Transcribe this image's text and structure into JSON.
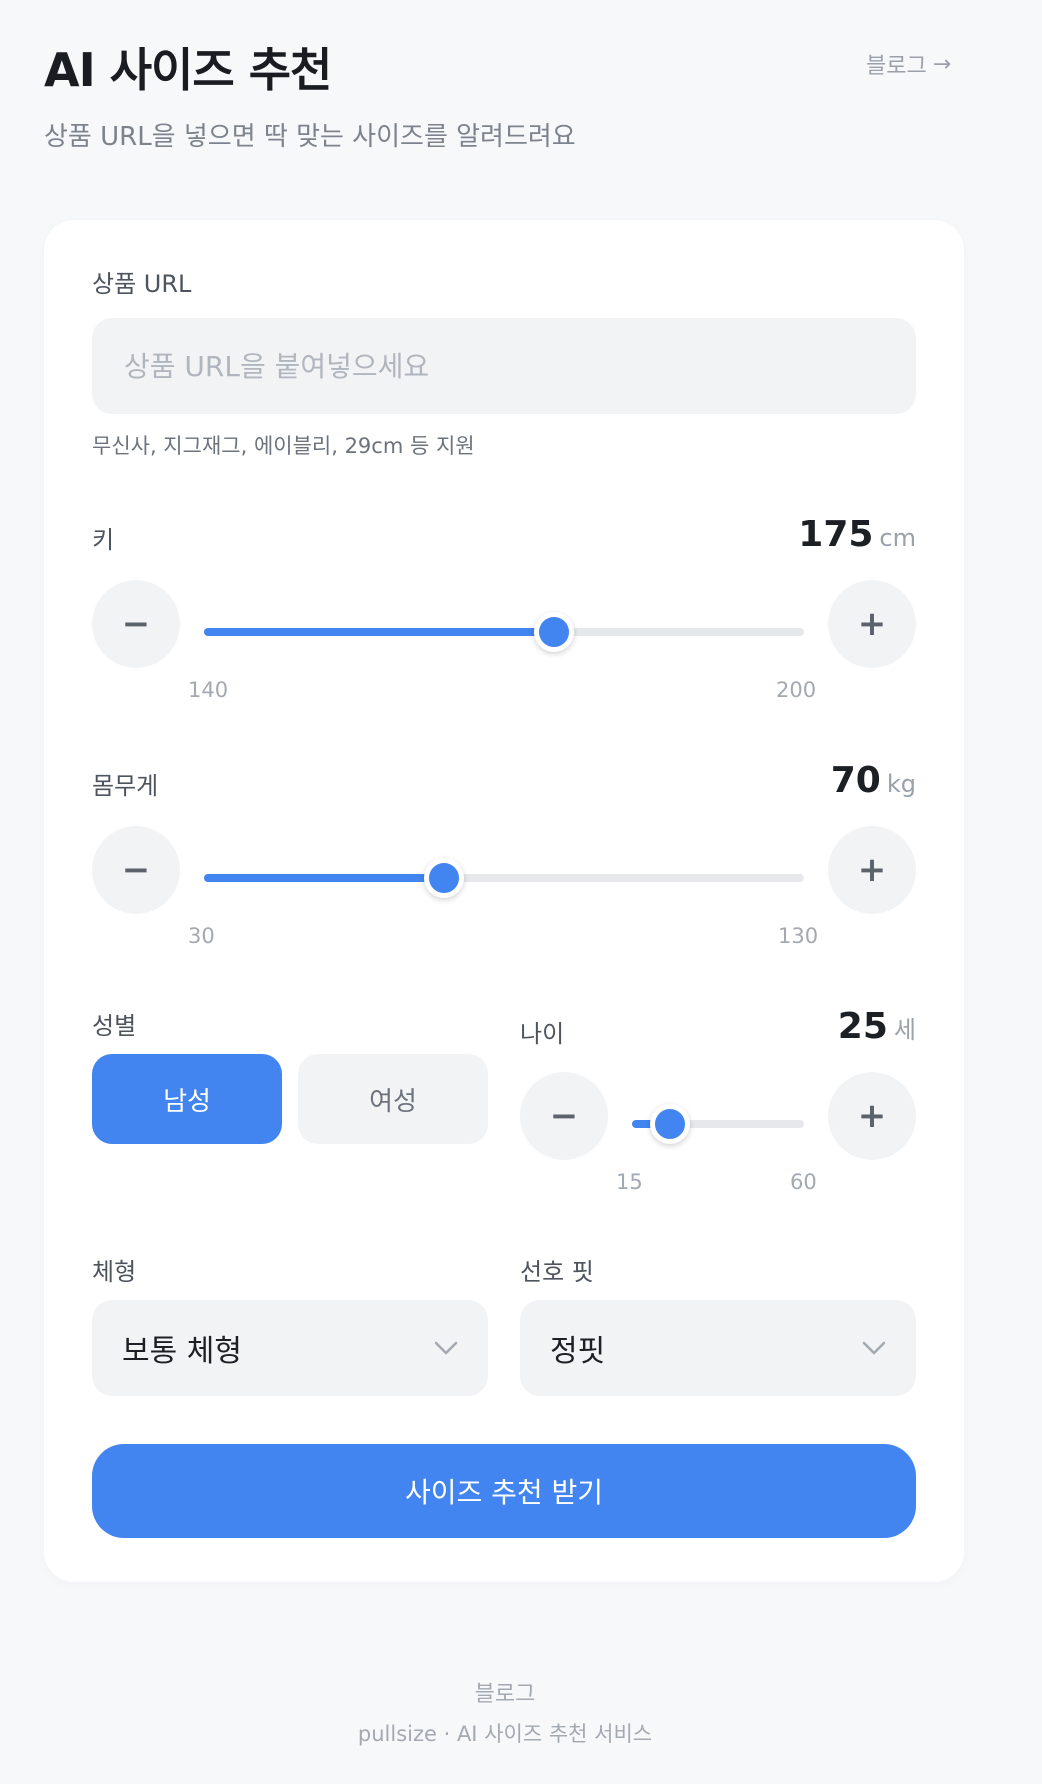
{
  "header": {
    "title": "AI 사이즈 추천",
    "subtitle": "상품 URL을 넣으면 딱 맞는 사이즈를 알려드려요",
    "blog_link": "블로그",
    "blog_arrow": "→"
  },
  "form": {
    "url": {
      "label": "상품 URL",
      "placeholder": "상품 URL을 붙여넣으세요",
      "value": "",
      "helper": "무신사, 지그재그, 에이블리, 29cm 등 지원"
    },
    "height": {
      "label": "키",
      "value": "175",
      "unit": "cm",
      "min": "140",
      "max": "200",
      "minus": "−",
      "plus": "+"
    },
    "weight": {
      "label": "몸무게",
      "value": "70",
      "unit": "kg",
      "min": "30",
      "max": "130",
      "minus": "−",
      "plus": "+"
    },
    "gender": {
      "label": "성별",
      "options": [
        "남성",
        "여성"
      ],
      "selected": "남성"
    },
    "age": {
      "label": "나이",
      "value": "25",
      "unit": "세",
      "min": "15",
      "max": "60",
      "minus": "−",
      "plus": "+"
    },
    "body_type": {
      "label": "체형",
      "value": "보통 체형"
    },
    "fit": {
      "label": "선호 핏",
      "value": "정핏"
    },
    "submit": "사이즈 추천 받기"
  },
  "footer": {
    "link": "블로그",
    "text": "pullsize · AI 사이즈 추천 서비스"
  },
  "colors": {
    "accent": "#4285f0",
    "background": "#f7f8fa",
    "card": "#ffffff",
    "input_bg": "#f2f3f5"
  }
}
